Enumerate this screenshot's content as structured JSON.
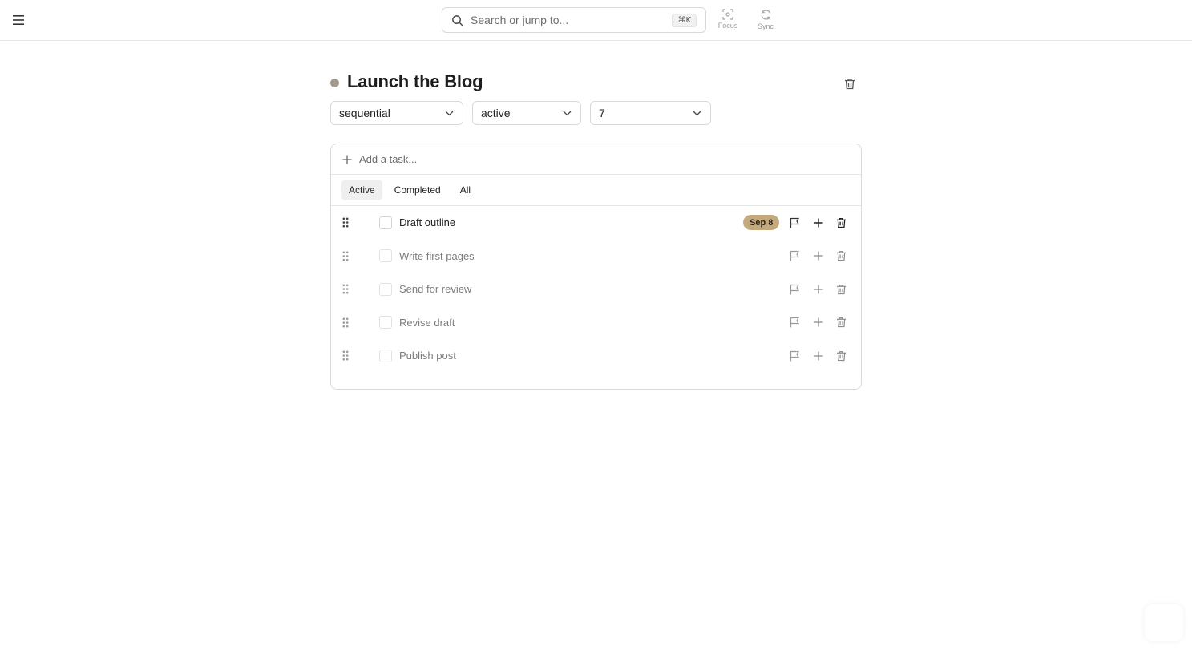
{
  "topbar": {
    "search_placeholder": "Search or jump to...",
    "shortcut": "⌘K",
    "focus_label": "Focus",
    "sync_label": "Sync"
  },
  "project": {
    "title": "Launch the Blog",
    "dot_color": "#a39a8f",
    "type": "sequential",
    "status": "active",
    "number": "7"
  },
  "task_list": {
    "add_placeholder": "Add a task...",
    "tabs": [
      {
        "label": "Active",
        "selected": true
      },
      {
        "label": "Completed",
        "selected": false
      },
      {
        "label": "All",
        "selected": false
      }
    ],
    "tasks": [
      {
        "title": "Draft outline",
        "due": "Sep 8",
        "emphasis": "primary"
      },
      {
        "title": "Write first pages",
        "due": "",
        "emphasis": "dim"
      },
      {
        "title": "Send for review",
        "due": "",
        "emphasis": "dim"
      },
      {
        "title": "Revise draft",
        "due": "",
        "emphasis": "dim"
      },
      {
        "title": "Publish post",
        "due": "",
        "emphasis": "dim"
      }
    ]
  },
  "colors": {
    "due_badge_bg": "#c4a97f",
    "border": "#dadada"
  },
  "icons": [
    "menu-icon",
    "search-icon",
    "focus-icon",
    "sync-icon",
    "trash-icon",
    "chevron-down-icon",
    "plus-icon",
    "drag-handle-icon",
    "flag-icon"
  ]
}
